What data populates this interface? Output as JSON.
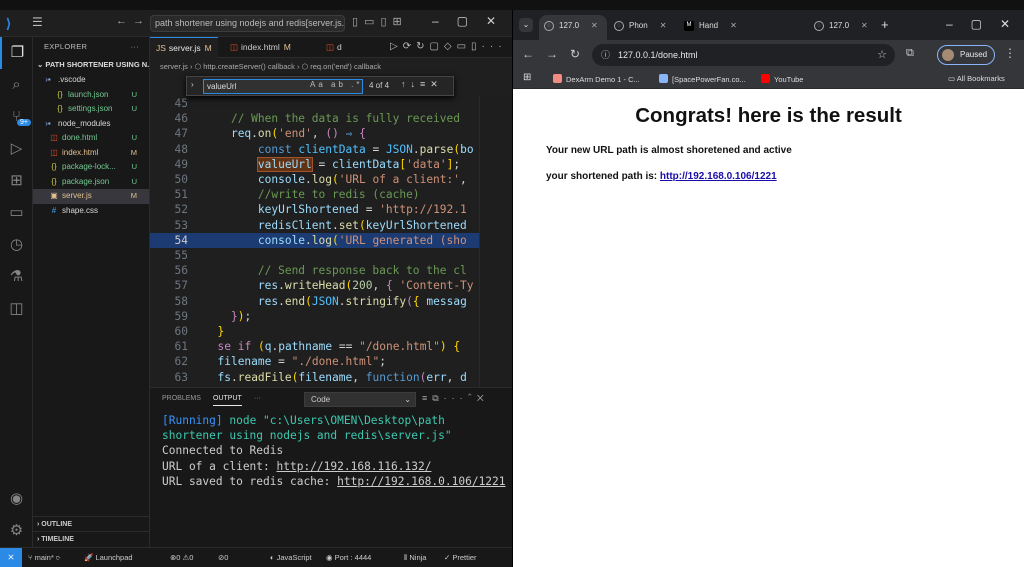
{
  "vscode": {
    "titlebar": {
      "search": "path shortener using nodejs and redis[server.js.....path"
    },
    "explorer": {
      "title": "EXPLORER",
      "project": "PATH SHORTENER USING N...",
      "files": [
        {
          "name": ".vscode",
          "status": "",
          "icon": "folder",
          "color": "#d8d8d8"
        },
        {
          "name": "launch.json",
          "status": "U",
          "icon": "{}",
          "color": "#73c991"
        },
        {
          "name": "settings.json",
          "status": "U",
          "icon": "{}",
          "color": "#73c991"
        },
        {
          "name": "node_modules",
          "status": "",
          "icon": "folder",
          "color": "#d8d8d8"
        },
        {
          "name": "done.html",
          "status": "U",
          "icon": "<>",
          "color": "#73c991"
        },
        {
          "name": "index.html",
          "status": "M",
          "icon": "<>",
          "color": "#e2c08d"
        },
        {
          "name": "package-lock...",
          "status": "U",
          "icon": "{}",
          "color": "#73c991"
        },
        {
          "name": "package.json",
          "status": "U",
          "icon": "{}",
          "color": "#73c991"
        },
        {
          "name": "server.js",
          "status": "M",
          "icon": "JS",
          "color": "#e2c08d"
        },
        {
          "name": "shape.css",
          "status": "",
          "icon": "#",
          "color": "#d8d8d8"
        }
      ],
      "outline": "OUTLINE",
      "timeline": "TIMELINE"
    },
    "tabs": [
      {
        "label": "server.js",
        "mark": "M"
      },
      {
        "label": "index.html",
        "mark": "M"
      },
      {
        "label": "d",
        "mark": ""
      }
    ],
    "breadcrumb": "server.js  ›  ⬡ http.createServer() callback  ›  ⬡ req.on('end') callback",
    "find": {
      "value": "valueUrl",
      "options": "Aa ab .*",
      "count": "4 of 4"
    },
    "code": [
      {
        "n": "45",
        "html": ""
      },
      {
        "n": "46",
        "html": "    <span class='cm'>// When the data is fully received</span>"
      },
      {
        "n": "47",
        "html": "    <span class='var'>req</span><span class='pl'>.</span><span class='fn'>on</span><span class='br'>(</span><span class='str'>'end'</span><span class='pl'>, </span><span class='kp'>()</span><span class='pl'> </span><span class='kw'>⇒</span><span class='pl'> </span><span class='kp'>{</span>"
      },
      {
        "n": "48",
        "html": "        <span class='kw'>const</span> <span class='cn'>clientData</span> <span class='pl'>=</span> <span class='cn'>JSON</span><span class='pl'>.</span><span class='fn'>parse</span><span class='br'>(</span><span class='var'>bo</span>"
      },
      {
        "n": "49",
        "html": "        <span class='var found'>valueUrl</span> <span class='pl'>=</span> <span class='var'>clientData</span><span class='br'>[</span><span class='str'>'data'</span><span class='br'>]</span><span class='pl'>;</span>"
      },
      {
        "n": "50",
        "html": "        <span class='var'>console</span><span class='pl'>.</span><span class='fn'>log</span><span class='br'>(</span><span class='str'>'URL of a client:'</span><span class='pl'>,</span>"
      },
      {
        "n": "51",
        "html": "        <span class='cm'>//write to redis (cache)</span>"
      },
      {
        "n": "52",
        "html": "        <span class='var'>keyUrlShortened</span> <span class='pl'>=</span> <span class='str'>'http://192.1</span>"
      },
      {
        "n": "53",
        "html": "        <span class='var'>redisClient</span><span class='pl'>.</span><span class='fn'>set</span><span class='br'>(</span><span class='var'>keyUrlShortened</span>"
      },
      {
        "n": "54",
        "html": "        <span class='var'>console</span><span class='pl'>.</span><span class='fn'>log</span><span class='br'>(</span><span class='str'>'URL generated (sho</span>",
        "hl": true
      },
      {
        "n": "55",
        "html": ""
      },
      {
        "n": "56",
        "html": "        <span class='cm'>// Send response back to the cl</span>"
      },
      {
        "n": "57",
        "html": "        <span class='var'>res</span><span class='pl'>.</span><span class='fn'>writeHead</span><span class='br'>(</span><span class='num2'>200</span><span class='pl'>, </span><span class='kp'>{</span> <span class='str'>'Content-Ty</span>"
      },
      {
        "n": "58",
        "html": "        <span class='var'>res</span><span class='pl'>.</span><span class='fn'>end</span><span class='br'>(</span><span class='cn'>JSON</span><span class='pl'>.</span><span class='fn'>stringify</span><span class='kp'>(</span><span class='br'>{</span> <span class='var'>messag</span>"
      },
      {
        "n": "59",
        "html": "    <span class='kp'>}</span><span class='br'>)</span><span class='pl'>;</span>"
      },
      {
        "n": "60",
        "html": "  <span class='br'>}</span>"
      },
      {
        "n": "61",
        "html": "  <span class='kp'>se</span> <span class='kp'>if</span> <span class='br'>(</span><span class='var'>q</span><span class='pl'>.</span><span class='var'>pathname</span> <span class='pl'>==</span> <span class='str'>\"/done.html\"</span><span class='br'>)</span> <span class='br'>{</span>"
      },
      {
        "n": "62",
        "html": "  <span class='var'>filename</span> <span class='pl'>=</span> <span class='str'>\"./done.html\"</span><span class='pl'>;</span>"
      },
      {
        "n": "63",
        "html": "  <span class='var'>fs</span><span class='pl'>.</span><span class='fn'>readFile</span><span class='br'>(</span><span class='var'>filename</span><span class='pl'>,</span> <span class='kw'>function</span><span class='kp'>(</span><span class='var'>err</span><span class='pl'>,</span> <span class='var'>d</span>"
      }
    ],
    "panel": {
      "tabs": [
        "PROBLEMS",
        "OUTPUT",
        "···"
      ],
      "channel": "Code",
      "output": {
        "running": "[Running]",
        "command": " node \"c:\\Users\\OMEN\\Desktop\\path shortener using nodejs and redis\\server.js\"",
        "line2": "Connected to Redis",
        "line3_label": "URL of a client: ",
        "line3_url": "http://192.168.116.132/",
        "line4_label": "URL saved to redis cache: ",
        "line4_url": "http://192.168.0.106/1221"
      }
    },
    "status": {
      "branch": "main*",
      "launchpad": "Launchpad",
      "problems": "⊗0 ⚠0",
      "ports": "⊘0",
      "language": "JavaScript",
      "port": "Port : 4444",
      "ninja": "Ninja",
      "prettier": "Prettier"
    }
  },
  "chrome": {
    "tabs": [
      {
        "label": "127.0",
        "icon": "globe-icon",
        "active": true
      },
      {
        "label": "Phon",
        "icon": "globe-icon",
        "active": false
      },
      {
        "label": "Hand",
        "icon": "m-icon",
        "active": false
      },
      {
        "label": "127.0",
        "icon": "globe-icon",
        "active": false
      }
    ],
    "url": "127.0.0.1/done.html",
    "profile_status": "Paused",
    "bookmarks": [
      {
        "label": "DexArm Demo 1 - C...",
        "color": "#f28b82"
      },
      {
        "label": "[SpacePowerFan.co...",
        "color": "#8ab4f8"
      },
      {
        "label": "YouTube",
        "color": "#ff0000"
      }
    ],
    "all_bookmarks": "All Bookmarks",
    "page": {
      "heading": "Congrats! here is the result",
      "line1": "Your new URL path is almost shoretened and active",
      "line2_label": "your shortened path is: ",
      "line2_link": "http://192.168.0.106/1221"
    }
  }
}
